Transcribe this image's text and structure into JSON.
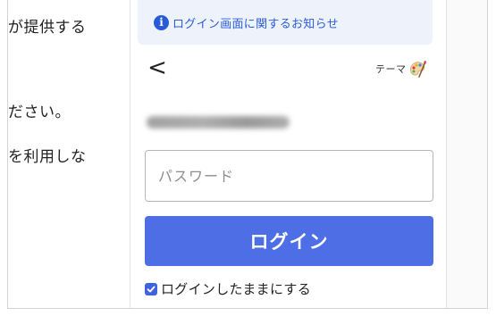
{
  "article": {
    "line1": "が提供する",
    "line2": "ださい。",
    "line3": "を利用しな"
  },
  "notice": {
    "icon": "info-icon",
    "text": "ログイン画面に関するお知らせ",
    "color": "#2a5bd7"
  },
  "header": {
    "back_icon": "chevron-left-icon",
    "back_glyph": "<",
    "theme_label": "テーマ"
  },
  "account": {
    "masked_id": "hiroko1983mail"
  },
  "form": {
    "password_placeholder": "パスワード",
    "login_label": "ログイン",
    "keep_logged_in_label": "ログインしたままにする",
    "keep_logged_in_checked": true
  },
  "colors": {
    "primary": "#4e6ee6",
    "checkbox": "#3f63e0"
  }
}
